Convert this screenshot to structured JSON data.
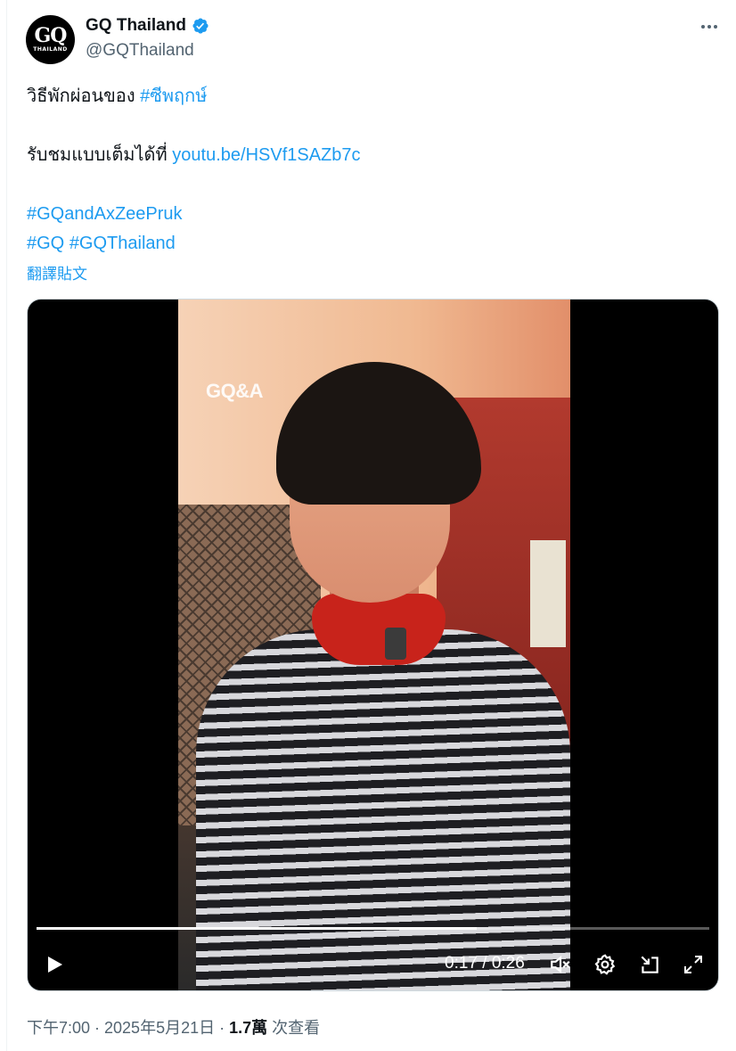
{
  "author": {
    "display_name": "GQ Thailand",
    "handle": "@GQThailand",
    "avatar_text": "GQ",
    "avatar_subtext": "THAILAND",
    "verified_color": "#1d9bf0"
  },
  "tweet": {
    "line1_text": "วิธีพักผ่อนของ ",
    "line1_hashtag": "#ซีพฤกษ์",
    "line2_text": "รับชมแบบเต็มได้ที่ ",
    "line2_link": "youtu.be/HSVf1SAZb7c",
    "hashtag_1": "#GQandAxZeePruk",
    "hashtag_2": "#GQ",
    "hashtag_3": "#GQThailand",
    "translate_label": "翻譯貼文"
  },
  "video": {
    "watermark": "GQ&A",
    "current_time": "0:17",
    "duration": "0:26",
    "time_display": "0:17 / 0:26",
    "progress_fraction": 0.654,
    "controls": [
      "play-icon",
      "volume-icon",
      "settings-icon",
      "pip-icon",
      "fullscreen-icon"
    ]
  },
  "meta": {
    "timestamp": "下午7:00 · 2025年5月21日 · ",
    "views_count": "1.7萬",
    "views_label": " 次查看"
  },
  "colors": {
    "link": "#1d9bf0",
    "secondary_text": "#536471",
    "primary_text": "#0f1419"
  }
}
